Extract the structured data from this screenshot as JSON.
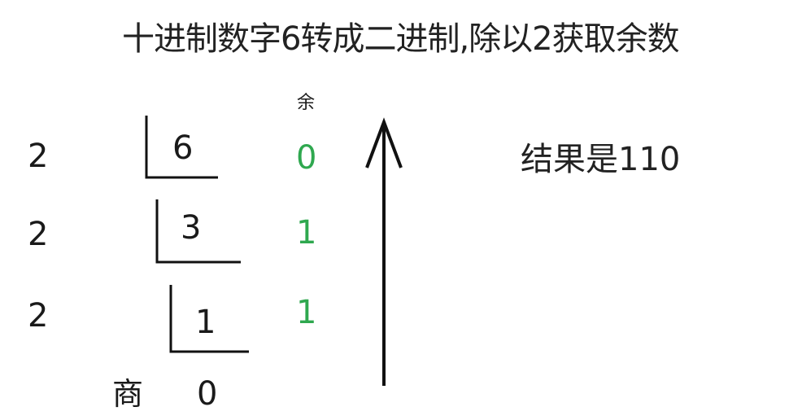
{
  "title": "十进制数字6转成二进制,除以2获取余数",
  "remainder_header": "余",
  "steps": [
    {
      "divisor": "2",
      "dividend": "6",
      "remainder": "0"
    },
    {
      "divisor": "2",
      "dividend": "3",
      "remainder": "1"
    },
    {
      "divisor": "2",
      "dividend": "1",
      "remainder": "1"
    }
  ],
  "final": {
    "label": "商",
    "value": "0"
  },
  "result": "结果是110",
  "colors": {
    "remainder": "#2fa84f",
    "text": "#1a1a1a",
    "lines": "#111111"
  }
}
